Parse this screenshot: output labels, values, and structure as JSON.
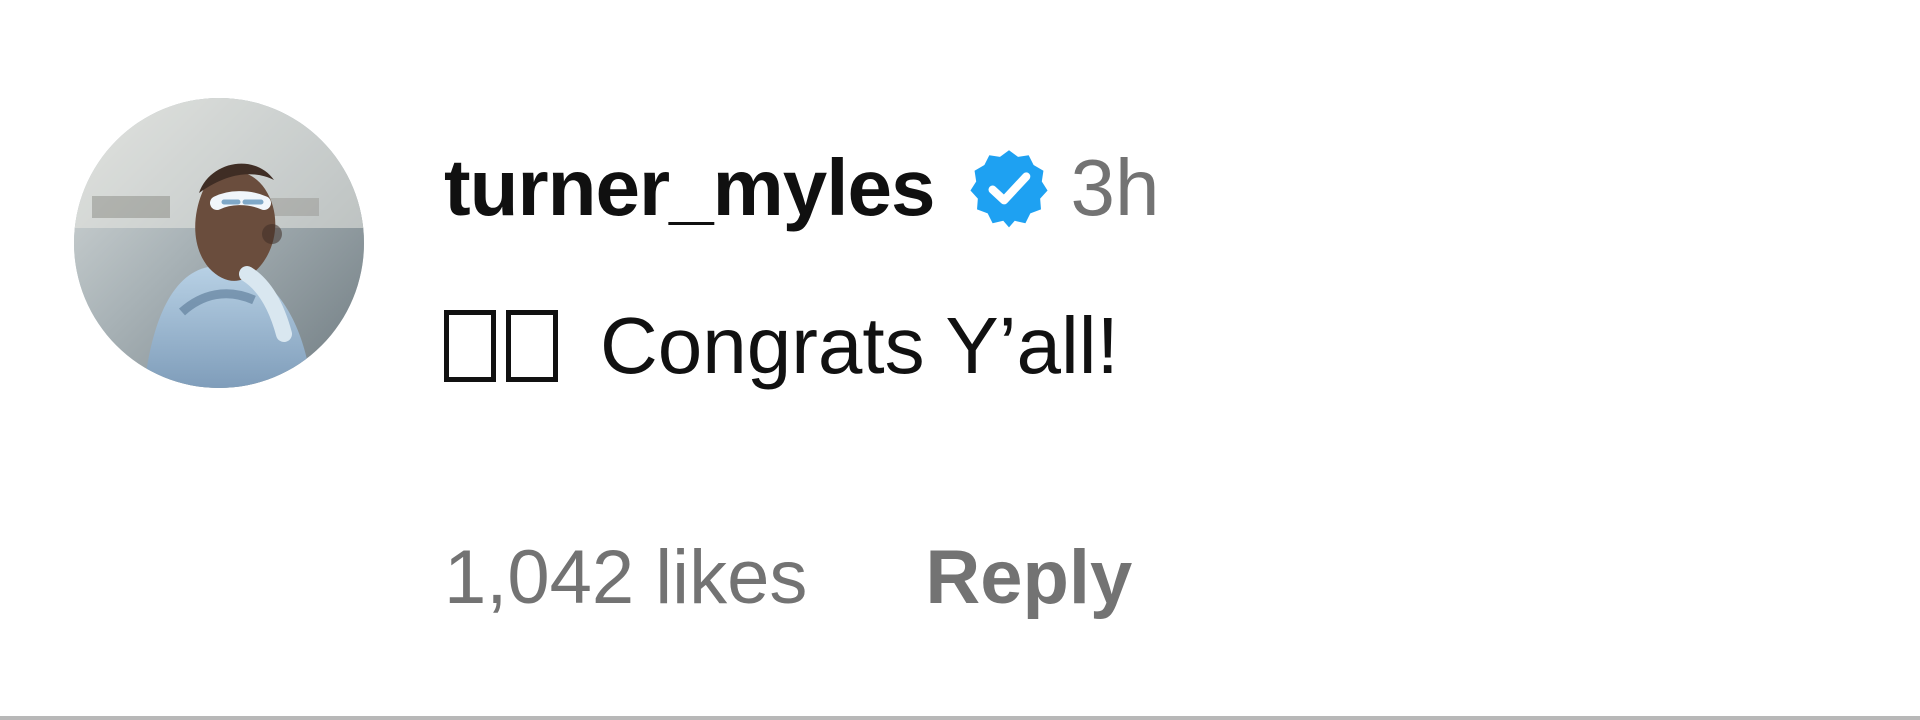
{
  "comment": {
    "username": "turner_myles",
    "timestamp": "3h",
    "emoji_placeholders": [
      "□",
      "□"
    ],
    "text": "Congrats Y’all!",
    "likes": "1,042 likes",
    "reply_label": "Reply",
    "verified_badge_icon": "verified-badge-icon",
    "avatar_icon": "profile-avatar"
  },
  "colors": {
    "background": "#ffffff",
    "text": "#111111",
    "secondary_text": "#737373",
    "verified_blue": "#1ea1f2"
  }
}
